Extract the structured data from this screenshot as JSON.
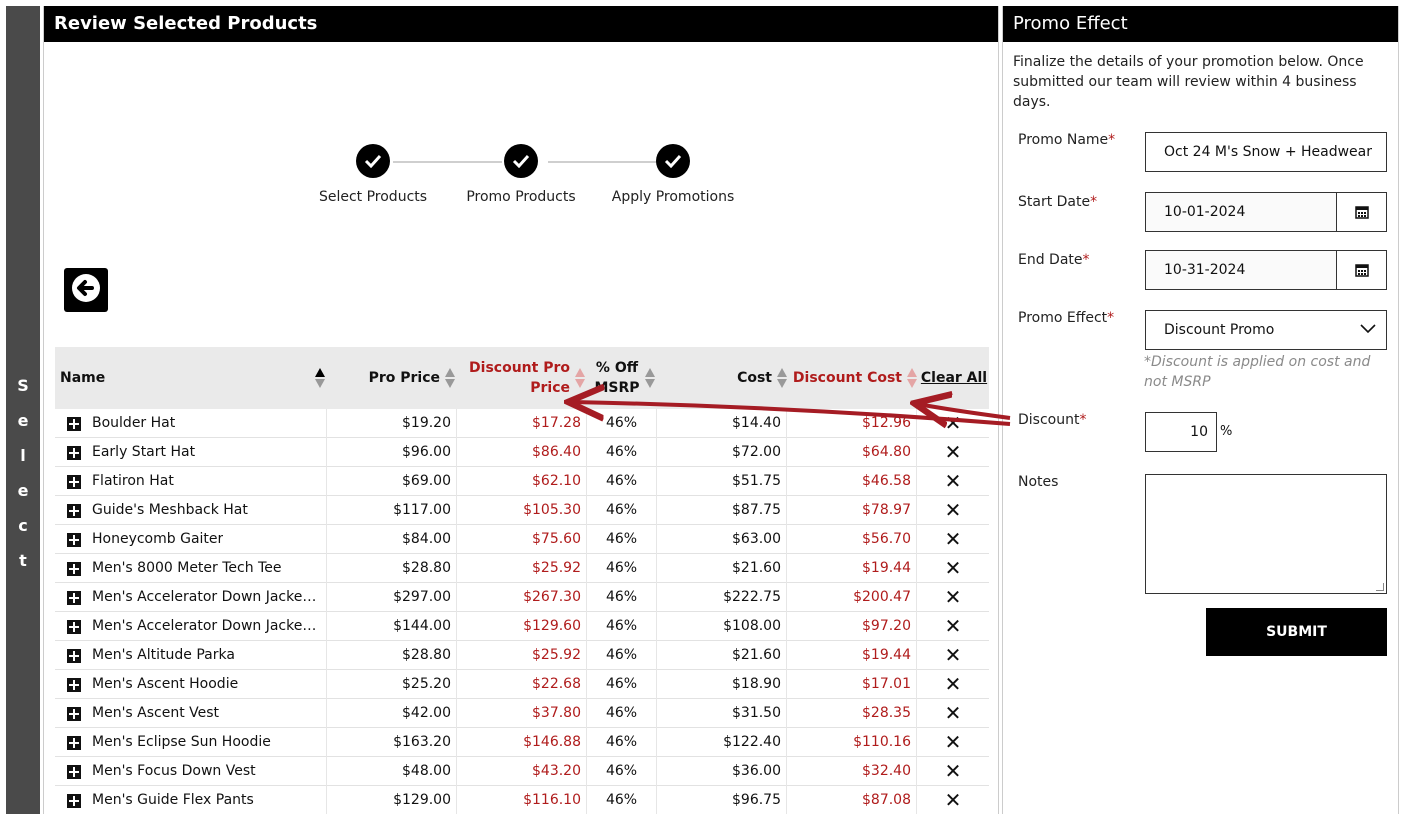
{
  "left_strip": {
    "letters": [
      "S",
      "e",
      "l",
      "e",
      "c",
      "t"
    ]
  },
  "review": {
    "title": "Review Selected Products",
    "steps": [
      "Select Products",
      "Promo Products",
      "Apply Promotions"
    ],
    "table": {
      "headers": {
        "name": "Name",
        "pro_price": "Pro Price",
        "discount_pro_price_1": "Discount Pro",
        "discount_pro_price_2": "Price",
        "pct_off_1": "% Off",
        "pct_off_2": "MSRP",
        "cost": "Cost",
        "discount_cost": "Discount Cost",
        "clear_all": "Clear All"
      },
      "rows": [
        {
          "name": "Boulder Hat",
          "pro": "$19.20",
          "dpro": "$17.28",
          "off": "46%",
          "cost": "$14.40",
          "dcost": "$12.96",
          "x": "✕"
        },
        {
          "name": "Early Start Hat",
          "pro": "$96.00",
          "dpro": "$86.40",
          "off": "46%",
          "cost": "$72.00",
          "dcost": "$64.80",
          "x": "✕"
        },
        {
          "name": "Flatiron Hat",
          "pro": "$69.00",
          "dpro": "$62.10",
          "off": "46%",
          "cost": "$51.75",
          "dcost": "$46.58",
          "x": "✕"
        },
        {
          "name": "Guide's Meshback Hat",
          "pro": "$117.00",
          "dpro": "$105.30",
          "off": "46%",
          "cost": "$87.75",
          "dcost": "$78.97",
          "x": "✕"
        },
        {
          "name": "Honeycomb Gaiter",
          "pro": "$84.00",
          "dpro": "$75.60",
          "off": "46%",
          "cost": "$63.00",
          "dcost": "$56.70",
          "x": "✕"
        },
        {
          "name": "Men's 8000 Meter Tech Tee",
          "pro": "$28.80",
          "dpro": "$25.92",
          "off": "46%",
          "cost": "$21.60",
          "dcost": "$19.44",
          "x": "✕"
        },
        {
          "name": "Men's Accelerator Down Jacket...",
          "pro": "$297.00",
          "dpro": "$267.30",
          "off": "46%",
          "cost": "$222.75",
          "dcost": "$200.47",
          "x": "✕"
        },
        {
          "name": "Men's Accelerator Down Jacket...",
          "pro": "$144.00",
          "dpro": "$129.60",
          "off": "46%",
          "cost": "$108.00",
          "dcost": "$97.20",
          "x": "✕"
        },
        {
          "name": "Men's Altitude Parka",
          "pro": "$28.80",
          "dpro": "$25.92",
          "off": "46%",
          "cost": "$21.60",
          "dcost": "$19.44",
          "x": "✕"
        },
        {
          "name": "Men's Ascent Hoodie",
          "pro": "$25.20",
          "dpro": "$22.68",
          "off": "46%",
          "cost": "$18.90",
          "dcost": "$17.01",
          "x": "✕"
        },
        {
          "name": "Men's Ascent Vest",
          "pro": "$42.00",
          "dpro": "$37.80",
          "off": "46%",
          "cost": "$31.50",
          "dcost": "$28.35",
          "x": "✕"
        },
        {
          "name": "Men's Eclipse Sun Hoodie",
          "pro": "$163.20",
          "dpro": "$146.88",
          "off": "46%",
          "cost": "$122.40",
          "dcost": "$110.16",
          "x": "✕"
        },
        {
          "name": "Men's Focus Down Vest",
          "pro": "$48.00",
          "dpro": "$43.20",
          "off": "46%",
          "cost": "$36.00",
          "dcost": "$32.40",
          "x": "✕"
        },
        {
          "name": "Men's Guide Flex Pants",
          "pro": "$129.00",
          "dpro": "$116.10",
          "off": "46%",
          "cost": "$96.75",
          "dcost": "$87.08",
          "x": "✕"
        }
      ]
    }
  },
  "promo": {
    "title": "Promo Effect",
    "intro": "Finalize the details of your promotion below. Once submitted our team will review within 4 business days.",
    "required_mark": "*",
    "promo_name": {
      "label": "Promo Name",
      "value": "Oct 24 M's Snow + Headwear"
    },
    "start_date": {
      "label": "Start Date",
      "value": "10-01-2024"
    },
    "end_date": {
      "label": "End Date",
      "value": "10-31-2024"
    },
    "promo_effect": {
      "label": "Promo Effect",
      "value": "Discount Promo",
      "hint": "*Discount is applied on cost and not MSRP"
    },
    "discount": {
      "label": "Discount",
      "value": "10",
      "unit": "%"
    },
    "notes": {
      "label": "Notes",
      "value": ""
    },
    "submit_label": "SUBMIT"
  },
  "colors": {
    "accent_red": "#b01c1c",
    "header_bg": "#000000",
    "strip_bg": "#4a4a4a",
    "annotation_red": "#a51c24"
  }
}
